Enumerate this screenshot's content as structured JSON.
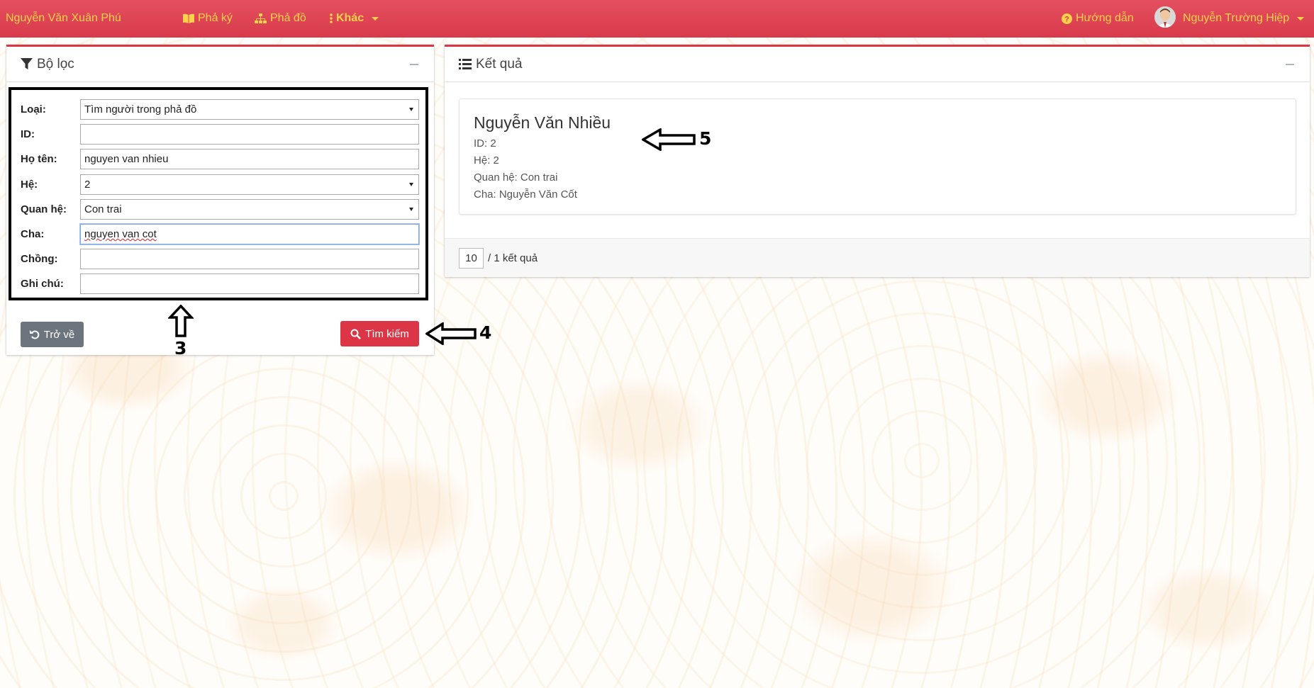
{
  "navbar": {
    "brand": "Nguyễn Văn Xuân Phú",
    "items": [
      {
        "label": "Phả ký",
        "icon": "book-icon"
      },
      {
        "label": "Phả đồ",
        "icon": "sitemap-icon"
      },
      {
        "label": "Khác",
        "icon": "vertical-ellipsis-icon"
      }
    ],
    "help": "Hướng dẫn",
    "user": "Nguyễn Trường Hiệp"
  },
  "filter": {
    "title": "Bộ lọc",
    "fields": [
      {
        "label": "Loại:",
        "value": "Tìm người trong phả đồ",
        "type": "select"
      },
      {
        "label": "ID:",
        "value": "",
        "type": "text"
      },
      {
        "label": "Họ tên:",
        "value": "nguyen van nhieu",
        "type": "text"
      },
      {
        "label": "Hệ:",
        "value": "2",
        "type": "select"
      },
      {
        "label": "Quan hệ:",
        "value": "Con trai",
        "type": "select"
      },
      {
        "label": "Cha:",
        "value": "nguyen van cot",
        "type": "text"
      },
      {
        "label": "Chồng:",
        "value": "",
        "type": "text"
      },
      {
        "label": "Ghi chú:",
        "value": "",
        "type": "text"
      }
    ],
    "back_label": "Trở về",
    "search_label": "Tìm kiếm"
  },
  "results": {
    "title": "Kết quả",
    "items": [
      {
        "name": "Nguyễn Văn Nhiều",
        "id": "ID: 2",
        "he": "Hệ: 2",
        "relation": "Quan hệ: Con trai",
        "father": "Cha: Nguyễn Văn Cốt"
      }
    ],
    "page_size": "10",
    "count_text": "/ 1 kết quả"
  },
  "annotations": [
    "3",
    "4",
    "5"
  ],
  "colors": {
    "navbar": "#dc3545",
    "nav_text": "#ffd24a",
    "search_button": "#dc3545",
    "back_button": "#6c757d"
  }
}
